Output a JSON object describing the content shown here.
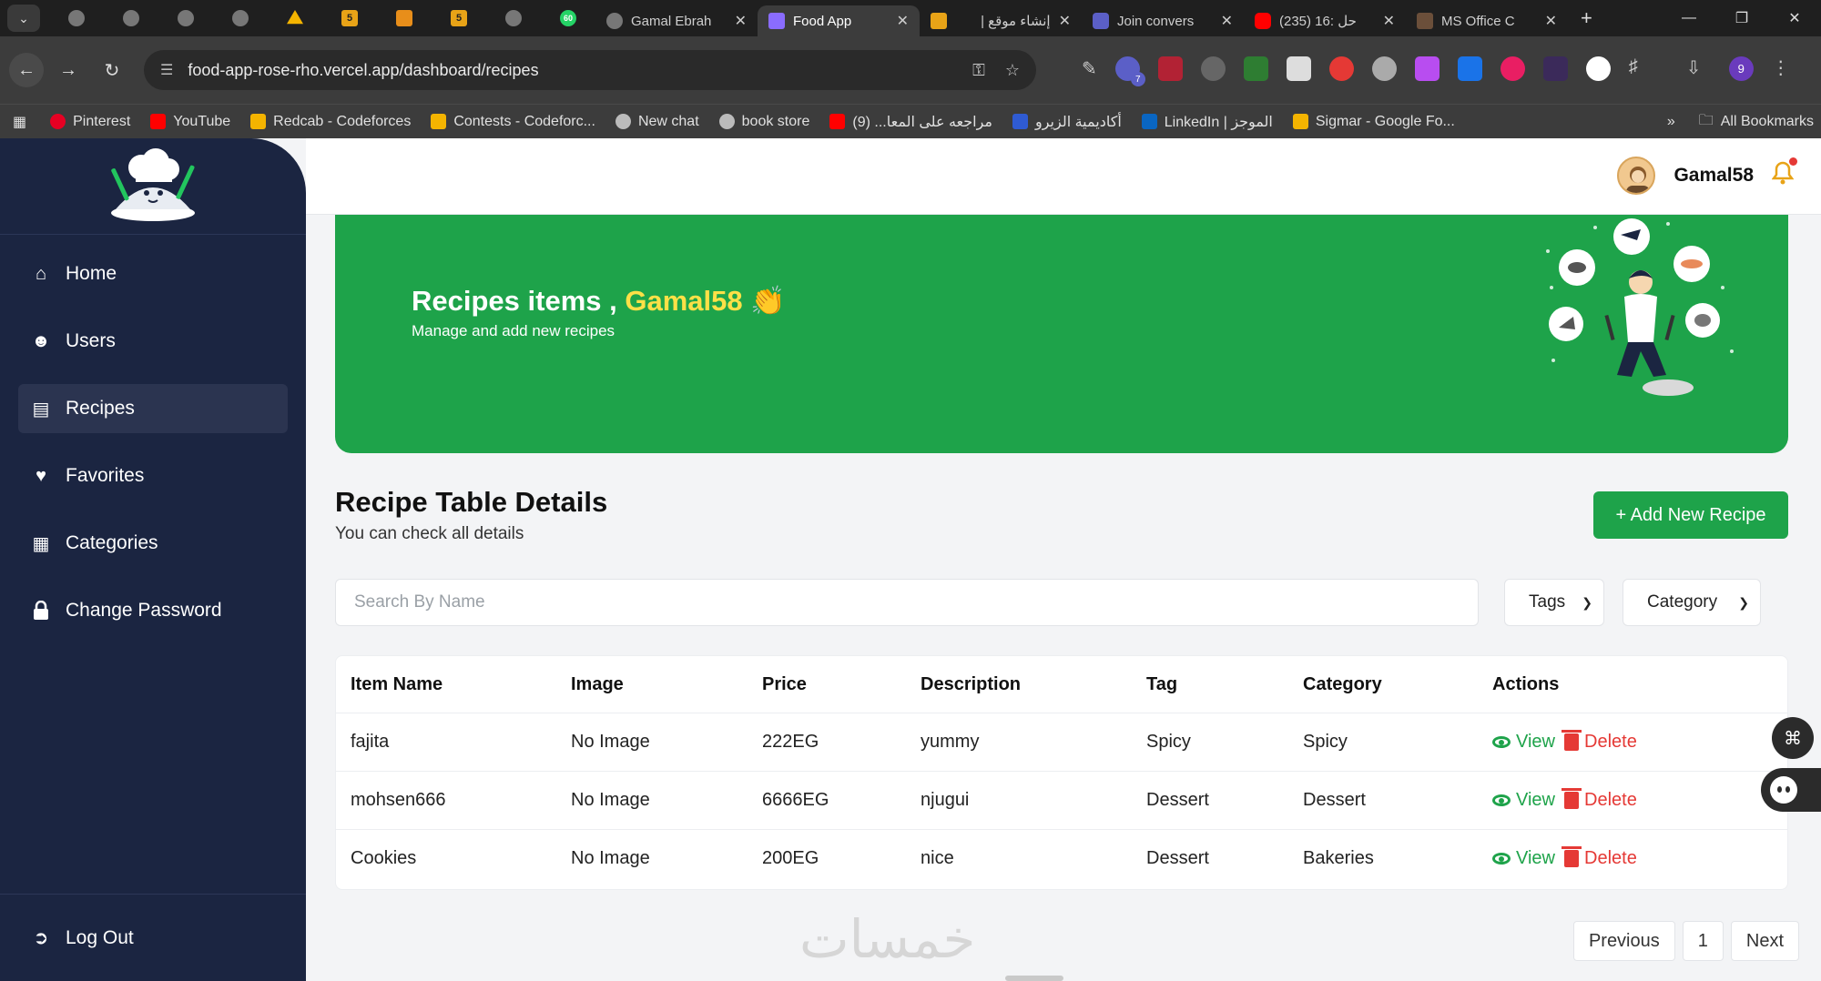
{
  "browser": {
    "tabs": [
      {
        "title": "Gamal Ebrah",
        "active": false
      },
      {
        "title": "Food App",
        "active": true
      },
      {
        "title": "إنشاء موقع |",
        "active": false
      },
      {
        "title": "Join convers",
        "active": false
      },
      {
        "title": "(235) 16: حل",
        "active": false
      },
      {
        "title": "MS Office C",
        "active": false
      }
    ],
    "url": "food-app-rose-rho.vercel.app/dashboard/recipes",
    "bookmarks": [
      "Pinterest",
      "YouTube",
      "Redcab - Codeforces",
      "Contests - Codeforc...",
      "New chat",
      "book store",
      "مراجعه على المعا... (9)",
      "أكاديمية الزيرو",
      "LinkedIn | الموجز",
      "Sigmar - Google Fo..."
    ],
    "all_bookmarks": "All Bookmarks",
    "more_chevron": "»",
    "pinned_badge": "60",
    "ext_badge": "7",
    "profile_badge": "9"
  },
  "sidebar": {
    "items": [
      {
        "label": "Home",
        "icon": "home-icon"
      },
      {
        "label": "Users",
        "icon": "users-icon"
      },
      {
        "label": "Recipes",
        "icon": "recipes-icon",
        "active": true
      },
      {
        "label": "Favorites",
        "icon": "heart-icon"
      },
      {
        "label": "Categories",
        "icon": "grid-icon"
      },
      {
        "label": "Change Password",
        "icon": "lock-icon"
      }
    ],
    "logout": "Log Out"
  },
  "header": {
    "username": "Gamal58"
  },
  "banner": {
    "title": "Recipes items ,",
    "username": "Gamal58",
    "emoji": "👏",
    "subtitle": "Manage and add new recipes"
  },
  "section": {
    "title": "Recipe Table Details",
    "subtitle": "You can check all details",
    "add_button": "+ Add New Recipe"
  },
  "filters": {
    "search_placeholder": "Search By Name",
    "tags_label": "Tags",
    "category_label": "Category"
  },
  "table": {
    "columns": [
      "Item Name",
      "Image",
      "Price",
      "Description",
      "Tag",
      "Category",
      "Actions"
    ],
    "rows": [
      {
        "name": "fajita",
        "image": "No Image",
        "price": "222EG",
        "description": "yummy",
        "tag": "Spicy",
        "category": "Spicy"
      },
      {
        "name": "mohsen666",
        "image": "No Image",
        "price": "6666EG",
        "description": "njugui",
        "tag": "Dessert",
        "category": "Dessert"
      },
      {
        "name": "Cookies",
        "image": "No Image",
        "price": "200EG",
        "description": "nice",
        "tag": "Dessert",
        "category": "Bakeries"
      }
    ],
    "view_label": "View",
    "delete_label": "Delete"
  },
  "pagination": {
    "previous": "Previous",
    "page": "1",
    "next": "Next"
  },
  "watermark": "خمسات",
  "colors": {
    "sidebar": "#1b2541",
    "brand_green": "#1ea34a",
    "highlight_yellow": "#fde047",
    "delete_red": "#e53935"
  }
}
